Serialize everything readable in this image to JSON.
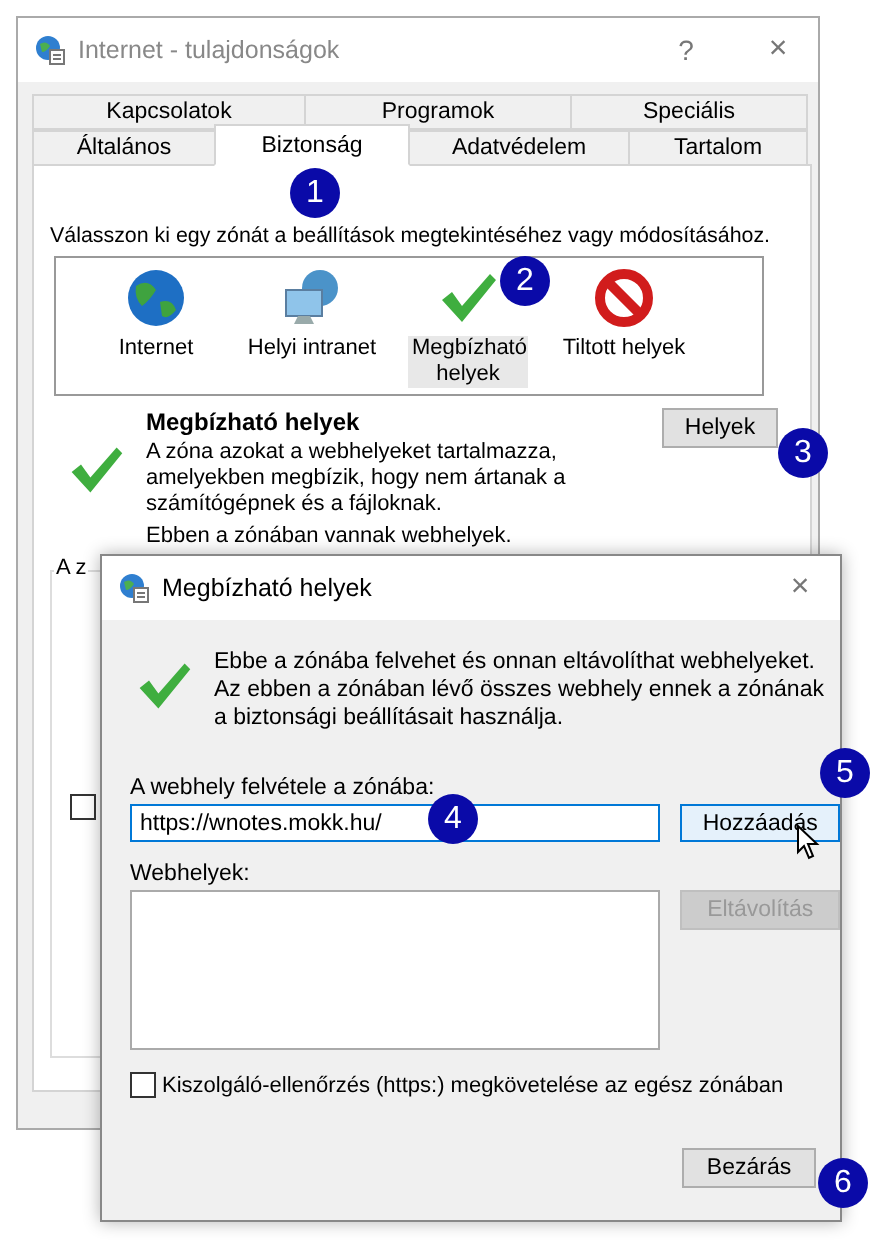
{
  "window": {
    "title": "Internet - tulajdonságok",
    "help": "?",
    "close": "×"
  },
  "tab_rows": [
    [
      {
        "label": "Kapcsolatok",
        "selected": false
      },
      {
        "label": "Programok",
        "selected": false
      },
      {
        "label": "Speciális",
        "selected": false
      }
    ],
    [
      {
        "label": "Általános",
        "selected": false
      },
      {
        "label": "Biztonság",
        "selected": true
      },
      {
        "label": "Adatvédelem",
        "selected": false
      },
      {
        "label": "Tartalom",
        "selected": false
      }
    ]
  ],
  "security": {
    "prompt": "Válasszon ki egy zónát a beállítások megtekintéséhez vagy módosításához.",
    "zones": [
      {
        "label": "Internet",
        "kind": "globe",
        "selected": false
      },
      {
        "label": "Helyi intranet",
        "kind": "intranet",
        "selected": false
      },
      {
        "label": "Megbízható helyek",
        "kind": "trusted",
        "selected": true
      },
      {
        "label": "Tiltott helyek",
        "kind": "restricted",
        "selected": false
      }
    ],
    "zone_title": "Megbízható helyek",
    "description": "A zóna azokat a webhelyeket tartalmazza, amelyekben megbízik, hogy nem ártanak a számítógépnek és a fájloknak.",
    "status": "Ebben a zónában vannak webhelyek.",
    "sites_button": "Helyek",
    "group_label": "A z",
    "checkbox": {
      "checked": false
    }
  },
  "dialog": {
    "title": "Megbízható helyek",
    "close": "×",
    "info": "Ebbe a zónába felvehet és onnan eltávolíthat webhelyeket. Az ebben a zónában lévő összes webhely ennek a zónának a biztonsági beállításait használja.",
    "add_label": "A webhely felvétele a zónába:",
    "url_value": "https://wnotes.mokk.hu/",
    "add_button": "Hozzáadás",
    "sites_label": "Webhelyek:",
    "remove_button": {
      "label": "Eltávolítás",
      "disabled": true
    },
    "https_check": {
      "label": "Kiszolgáló-ellenőrzés (https:) megkövetelése az egész zónában",
      "checked": false
    },
    "close_button": "Bezárás"
  },
  "callouts": [
    "1",
    "2",
    "3",
    "4",
    "5",
    "6"
  ]
}
